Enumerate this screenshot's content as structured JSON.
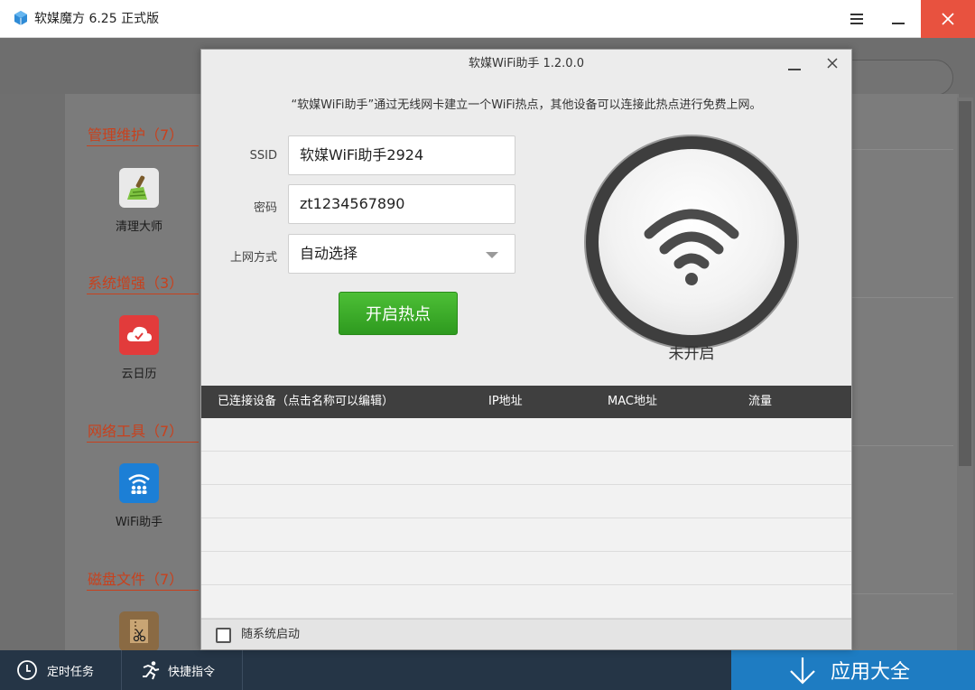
{
  "app": {
    "title": "软媒魔方 6.25 正式版"
  },
  "sidebar": {
    "categories": [
      {
        "title": "管理维护（7）",
        "app": {
          "label": "清理大师",
          "icon": "broom-icon"
        }
      },
      {
        "title": "系统增强（3）",
        "app": {
          "label": "云日历",
          "icon": "cloud-calendar-icon"
        }
      },
      {
        "title": "网络工具（7）",
        "app": {
          "label": "WiFi助手",
          "icon": "wifi-assistant-icon"
        }
      },
      {
        "title": "磁盘文件（7）",
        "app": {
          "label": "",
          "icon": "file-cutter-icon"
        }
      }
    ]
  },
  "bottombar": {
    "scheduled_tasks": "定时任务",
    "quick_commands": "快捷指令",
    "app_store": "应用大全"
  },
  "dialog": {
    "title": "软媒WiFi助手 1.2.0.0",
    "description": "“软媒WiFi助手”通过无线网卡建立一个WiFi热点，其他设备可以连接此热点进行免费上网。",
    "ssid_label": "SSID",
    "ssid_value": "软媒WiFi助手2924",
    "password_label": "密码",
    "password_value": "zt1234567890",
    "mode_label": "上网方式",
    "mode_value": "自动选择",
    "start_button": "开启热点",
    "status": "未开启",
    "table": {
      "columns": [
        "已连接设备（点击名称可以编辑）",
        "IP地址",
        "MAC地址",
        "流量"
      ],
      "rows": []
    },
    "autostart_label": "随系统启动"
  },
  "colors": {
    "category_title": "#c8411d",
    "start_button": "#3aab28",
    "app_store_bar": "#1e7cc2",
    "close_button": "#e8523f",
    "bottom_bar": "#253546"
  }
}
